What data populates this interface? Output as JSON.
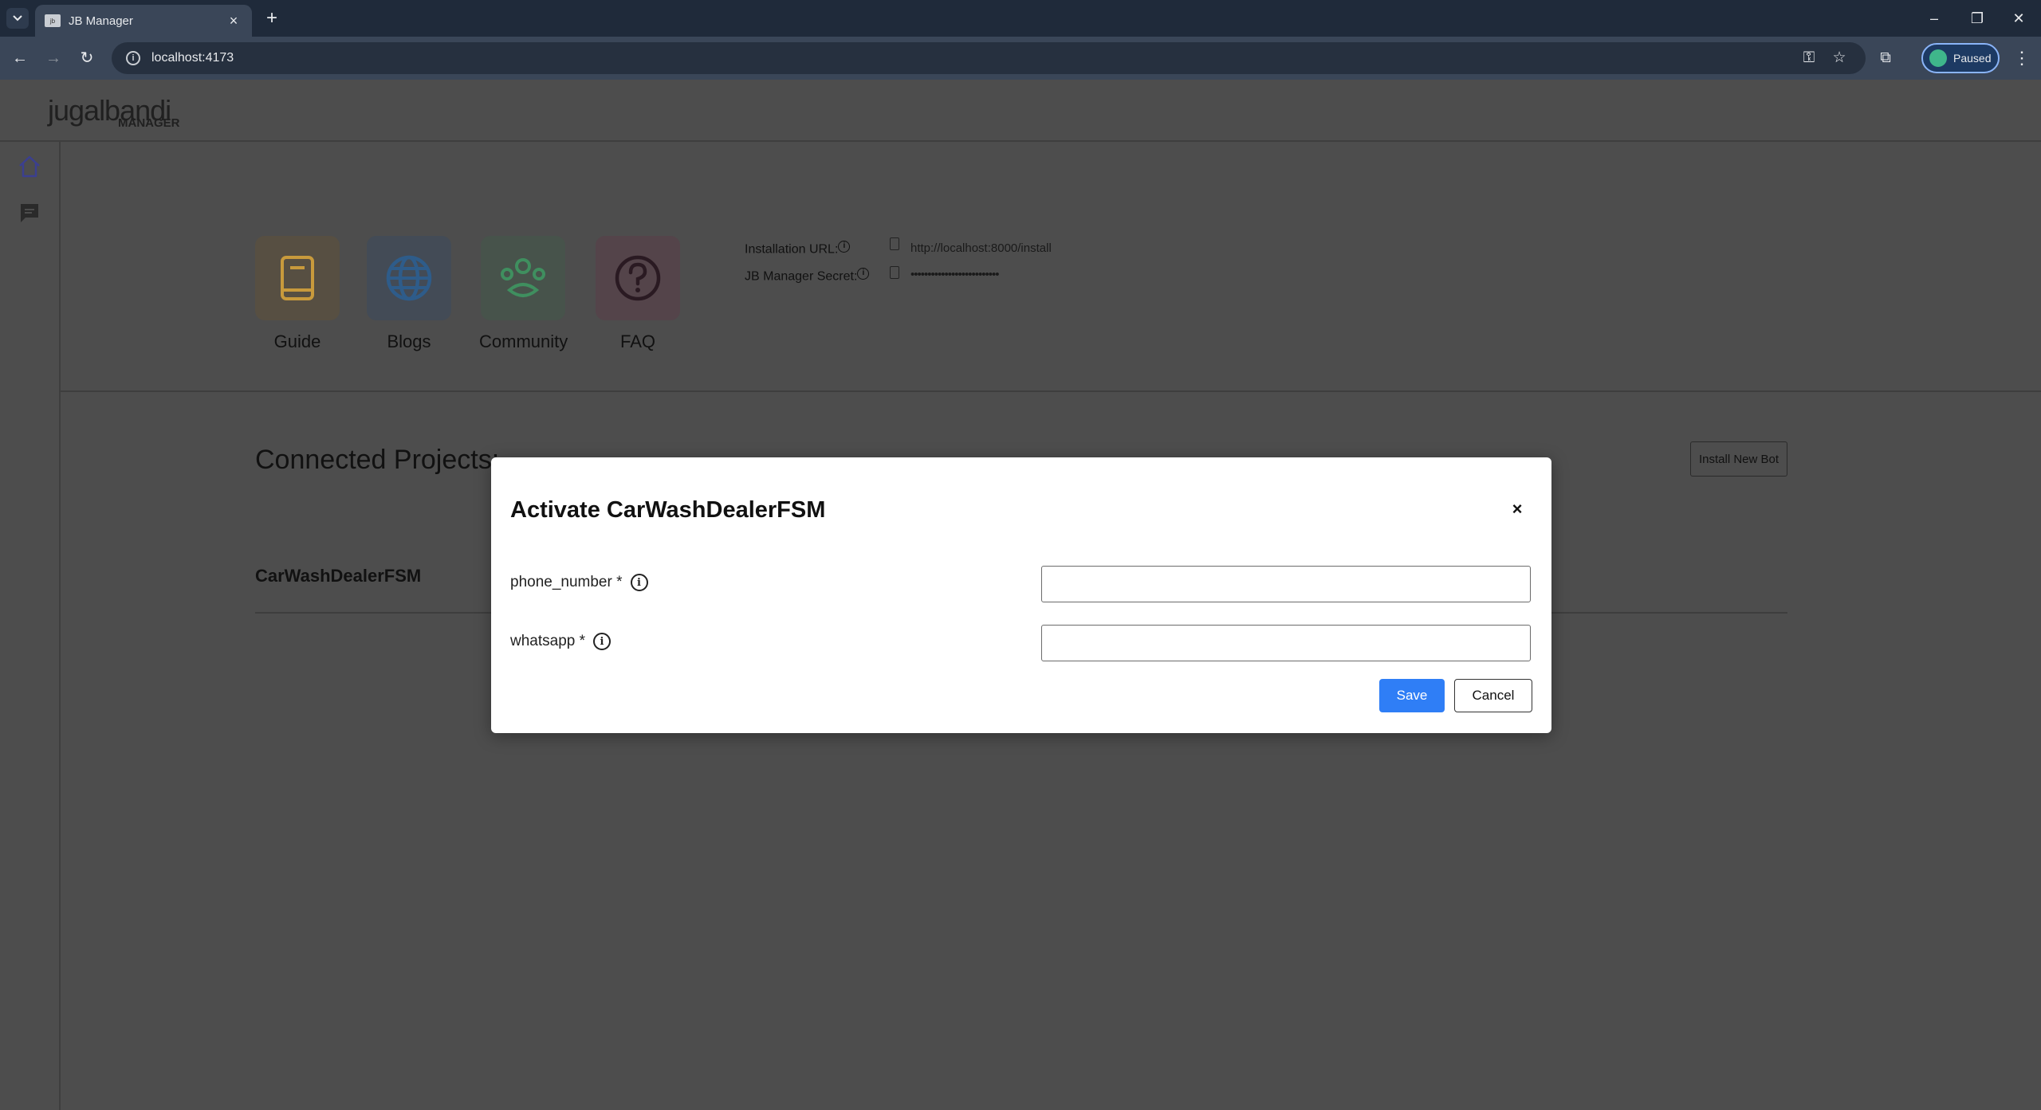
{
  "browser": {
    "tab_title": "JB Manager",
    "url": "localhost:4173",
    "profile_label": "Paused"
  },
  "app": {
    "logo_main": "jugalbandi",
    "logo_sub": "MANAGER",
    "quick_links": [
      {
        "label": "Guide",
        "icon": "book-icon",
        "color": "#c89a3c"
      },
      {
        "label": "Blogs",
        "icon": "globe-icon",
        "color": "#2e5c8a"
      },
      {
        "label": "Community",
        "icon": "people-icon",
        "color": "#3f8f5f"
      },
      {
        "label": "FAQ",
        "icon": "question-icon",
        "color": "#5a2236"
      }
    ],
    "installation_url_label": "Installation URL:",
    "installation_url_value": "http://localhost:8000/install",
    "secret_label": "JB Manager Secret:",
    "secret_value": "••••••••••••••••••••••••••",
    "projects_title": "Connected Projects:",
    "install_bot_label": "Install New Bot",
    "projects": [
      {
        "name": "CarWashDealerFSM"
      }
    ]
  },
  "modal": {
    "title": "Activate CarWashDealerFSM",
    "close_symbol": "×",
    "fields": [
      {
        "label": "phone_number *",
        "value": ""
      },
      {
        "label": "whatsapp *",
        "value": ""
      }
    ],
    "save_label": "Save",
    "cancel_label": "Cancel"
  },
  "colors": {
    "accent": "#2f7ef6",
    "overlay_bg": "#4d4d4d"
  }
}
